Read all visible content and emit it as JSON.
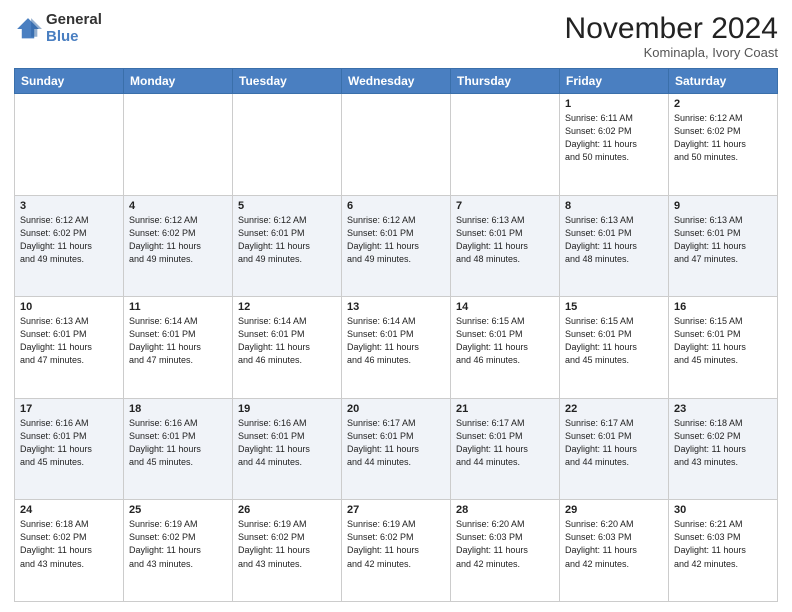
{
  "header": {
    "logo": {
      "line1": "General",
      "line2": "Blue"
    },
    "title": "November 2024",
    "location": "Kominapla, Ivory Coast"
  },
  "weekdays": [
    "Sunday",
    "Monday",
    "Tuesday",
    "Wednesday",
    "Thursday",
    "Friday",
    "Saturday"
  ],
  "weeks": [
    [
      {
        "day": "",
        "info": ""
      },
      {
        "day": "",
        "info": ""
      },
      {
        "day": "",
        "info": ""
      },
      {
        "day": "",
        "info": ""
      },
      {
        "day": "",
        "info": ""
      },
      {
        "day": "1",
        "info": "Sunrise: 6:11 AM\nSunset: 6:02 PM\nDaylight: 11 hours\nand 50 minutes."
      },
      {
        "day": "2",
        "info": "Sunrise: 6:12 AM\nSunset: 6:02 PM\nDaylight: 11 hours\nand 50 minutes."
      }
    ],
    [
      {
        "day": "3",
        "info": "Sunrise: 6:12 AM\nSunset: 6:02 PM\nDaylight: 11 hours\nand 49 minutes."
      },
      {
        "day": "4",
        "info": "Sunrise: 6:12 AM\nSunset: 6:02 PM\nDaylight: 11 hours\nand 49 minutes."
      },
      {
        "day": "5",
        "info": "Sunrise: 6:12 AM\nSunset: 6:01 PM\nDaylight: 11 hours\nand 49 minutes."
      },
      {
        "day": "6",
        "info": "Sunrise: 6:12 AM\nSunset: 6:01 PM\nDaylight: 11 hours\nand 49 minutes."
      },
      {
        "day": "7",
        "info": "Sunrise: 6:13 AM\nSunset: 6:01 PM\nDaylight: 11 hours\nand 48 minutes."
      },
      {
        "day": "8",
        "info": "Sunrise: 6:13 AM\nSunset: 6:01 PM\nDaylight: 11 hours\nand 48 minutes."
      },
      {
        "day": "9",
        "info": "Sunrise: 6:13 AM\nSunset: 6:01 PM\nDaylight: 11 hours\nand 47 minutes."
      }
    ],
    [
      {
        "day": "10",
        "info": "Sunrise: 6:13 AM\nSunset: 6:01 PM\nDaylight: 11 hours\nand 47 minutes."
      },
      {
        "day": "11",
        "info": "Sunrise: 6:14 AM\nSunset: 6:01 PM\nDaylight: 11 hours\nand 47 minutes."
      },
      {
        "day": "12",
        "info": "Sunrise: 6:14 AM\nSunset: 6:01 PM\nDaylight: 11 hours\nand 46 minutes."
      },
      {
        "day": "13",
        "info": "Sunrise: 6:14 AM\nSunset: 6:01 PM\nDaylight: 11 hours\nand 46 minutes."
      },
      {
        "day": "14",
        "info": "Sunrise: 6:15 AM\nSunset: 6:01 PM\nDaylight: 11 hours\nand 46 minutes."
      },
      {
        "day": "15",
        "info": "Sunrise: 6:15 AM\nSunset: 6:01 PM\nDaylight: 11 hours\nand 45 minutes."
      },
      {
        "day": "16",
        "info": "Sunrise: 6:15 AM\nSunset: 6:01 PM\nDaylight: 11 hours\nand 45 minutes."
      }
    ],
    [
      {
        "day": "17",
        "info": "Sunrise: 6:16 AM\nSunset: 6:01 PM\nDaylight: 11 hours\nand 45 minutes."
      },
      {
        "day": "18",
        "info": "Sunrise: 6:16 AM\nSunset: 6:01 PM\nDaylight: 11 hours\nand 45 minutes."
      },
      {
        "day": "19",
        "info": "Sunrise: 6:16 AM\nSunset: 6:01 PM\nDaylight: 11 hours\nand 44 minutes."
      },
      {
        "day": "20",
        "info": "Sunrise: 6:17 AM\nSunset: 6:01 PM\nDaylight: 11 hours\nand 44 minutes."
      },
      {
        "day": "21",
        "info": "Sunrise: 6:17 AM\nSunset: 6:01 PM\nDaylight: 11 hours\nand 44 minutes."
      },
      {
        "day": "22",
        "info": "Sunrise: 6:17 AM\nSunset: 6:01 PM\nDaylight: 11 hours\nand 44 minutes."
      },
      {
        "day": "23",
        "info": "Sunrise: 6:18 AM\nSunset: 6:02 PM\nDaylight: 11 hours\nand 43 minutes."
      }
    ],
    [
      {
        "day": "24",
        "info": "Sunrise: 6:18 AM\nSunset: 6:02 PM\nDaylight: 11 hours\nand 43 minutes."
      },
      {
        "day": "25",
        "info": "Sunrise: 6:19 AM\nSunset: 6:02 PM\nDaylight: 11 hours\nand 43 minutes."
      },
      {
        "day": "26",
        "info": "Sunrise: 6:19 AM\nSunset: 6:02 PM\nDaylight: 11 hours\nand 43 minutes."
      },
      {
        "day": "27",
        "info": "Sunrise: 6:19 AM\nSunset: 6:02 PM\nDaylight: 11 hours\nand 42 minutes."
      },
      {
        "day": "28",
        "info": "Sunrise: 6:20 AM\nSunset: 6:03 PM\nDaylight: 11 hours\nand 42 minutes."
      },
      {
        "day": "29",
        "info": "Sunrise: 6:20 AM\nSunset: 6:03 PM\nDaylight: 11 hours\nand 42 minutes."
      },
      {
        "day": "30",
        "info": "Sunrise: 6:21 AM\nSunset: 6:03 PM\nDaylight: 11 hours\nand 42 minutes."
      }
    ]
  ]
}
